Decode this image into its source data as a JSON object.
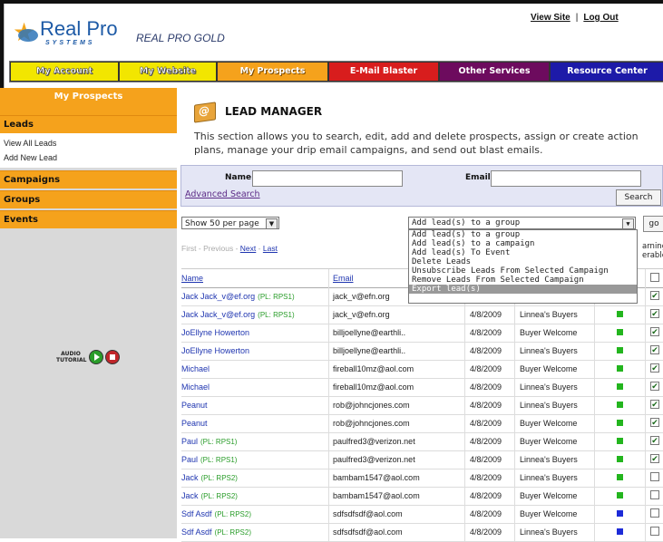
{
  "brand": {
    "logo_word": "Real Pro",
    "logo_sub": "SYSTEMS",
    "product": "REAL PRO GOLD"
  },
  "toplinks": {
    "view_site": "View Site",
    "separator": "|",
    "logout": "Log Out"
  },
  "nav": {
    "tabs": [
      {
        "label": "My Account"
      },
      {
        "label": "My Website"
      },
      {
        "label": "My Prospects"
      },
      {
        "label": "E-Mail Blaster"
      },
      {
        "label": "Other Services"
      },
      {
        "label": "Resource Center"
      }
    ]
  },
  "sidebar": {
    "header": "My Prospects",
    "leads": "Leads",
    "view_all": "View All Leads",
    "add_new": "Add New Lead",
    "campaigns": "Campaigns",
    "groups": "Groups",
    "events": "Events",
    "tutorial": "AUDIO TUTORIAL"
  },
  "lead_manager": {
    "title": "LEAD MANAGER",
    "description": "This section allows you to search, edit, add and delete prospects, assign or create action plans, manage your drip email campaigns, and send out blast emails."
  },
  "search": {
    "name_label": "Name",
    "email_label": "Email",
    "advanced": "Advanced Search",
    "button": "Search"
  },
  "controls": {
    "per_page": "Show 50 per page",
    "action_selected": "Add lead(s) to a group",
    "go": "go",
    "action_options": [
      "Add lead(s) to a group",
      "Add lead(s) to a campaign",
      "Add lead(s) To Event",
      "Delete Leads",
      "Unsubscribe Leads From Selected Campaign",
      "Remove Leads From Selected Campaign",
      "Export lead(s)"
    ],
    "highlighted_option": "Export lead(s)"
  },
  "pager": {
    "first": "First",
    "previous": "Previous",
    "next": "Next",
    "last": "Last",
    "sep": "-"
  },
  "truncated_header": {
    "line1": "arning",
    "line2": "erable"
  },
  "table": {
    "headers": {
      "name": "Name",
      "email": "Email"
    },
    "rows": [
      {
        "name": "Jack Jack_v@ef.org",
        "pl": "(PL: RPS1)",
        "email": "jack_v@efn.org",
        "date": "",
        "plan": "",
        "status": "",
        "checked": true
      },
      {
        "name": "Jack Jack_v@ef.org",
        "pl": "(PL: RPS1)",
        "email": "jack_v@efn.org",
        "date": "4/8/2009",
        "plan": "Linnea's Buyers",
        "status": "green",
        "checked": true
      },
      {
        "name": "JoEllyne Howerton",
        "pl": "",
        "email": "billjoellyne@earthli..",
        "date": "4/8/2009",
        "plan": "Buyer Welcome",
        "status": "green",
        "checked": true
      },
      {
        "name": "JoEllyne Howerton",
        "pl": "",
        "email": "billjoellyne@earthli..",
        "date": "4/8/2009",
        "plan": "Linnea's Buyers",
        "status": "green",
        "checked": true
      },
      {
        "name": "Michael",
        "pl": "",
        "email": "fireball10mz@aol.com",
        "date": "4/8/2009",
        "plan": "Buyer Welcome",
        "status": "green",
        "checked": true
      },
      {
        "name": "Michael",
        "pl": "",
        "email": "fireball10mz@aol.com",
        "date": "4/8/2009",
        "plan": "Linnea's Buyers",
        "status": "green",
        "checked": true
      },
      {
        "name": "Peanut",
        "pl": "",
        "email": "rob@johncjones.com",
        "date": "4/8/2009",
        "plan": "Linnea's Buyers",
        "status": "green",
        "checked": true
      },
      {
        "name": "Peanut",
        "pl": "",
        "email": "rob@johncjones.com",
        "date": "4/8/2009",
        "plan": "Buyer Welcome",
        "status": "green",
        "checked": true
      },
      {
        "name": "Paul",
        "pl": "(PL: RPS1)",
        "email": "paulfred3@verizon.net",
        "date": "4/8/2009",
        "plan": "Buyer Welcome",
        "status": "green",
        "checked": true
      },
      {
        "name": "Paul",
        "pl": "(PL: RPS1)",
        "email": "paulfred3@verizon.net",
        "date": "4/8/2009",
        "plan": "Linnea's Buyers",
        "status": "green",
        "checked": true
      },
      {
        "name": "Jack",
        "pl": "(PL: RPS2)",
        "email": "bambam1547@aol.com",
        "date": "4/8/2009",
        "plan": "Linnea's Buyers",
        "status": "green",
        "checked": false
      },
      {
        "name": "Jack",
        "pl": "(PL: RPS2)",
        "email": "bambam1547@aol.com",
        "date": "4/8/2009",
        "plan": "Buyer Welcome",
        "status": "green",
        "checked": false
      },
      {
        "name": "Sdf Asdf",
        "pl": "(PL: RPS2)",
        "email": "sdfsdfsdf@aol.com",
        "date": "4/8/2009",
        "plan": "Buyer Welcome",
        "status": "blue",
        "checked": false
      },
      {
        "name": "Sdf Asdf",
        "pl": "(PL: RPS2)",
        "email": "sdfsdfsdf@aol.com",
        "date": "4/8/2009",
        "plan": "Linnea's Buyers",
        "status": "blue",
        "checked": false
      }
    ]
  }
}
